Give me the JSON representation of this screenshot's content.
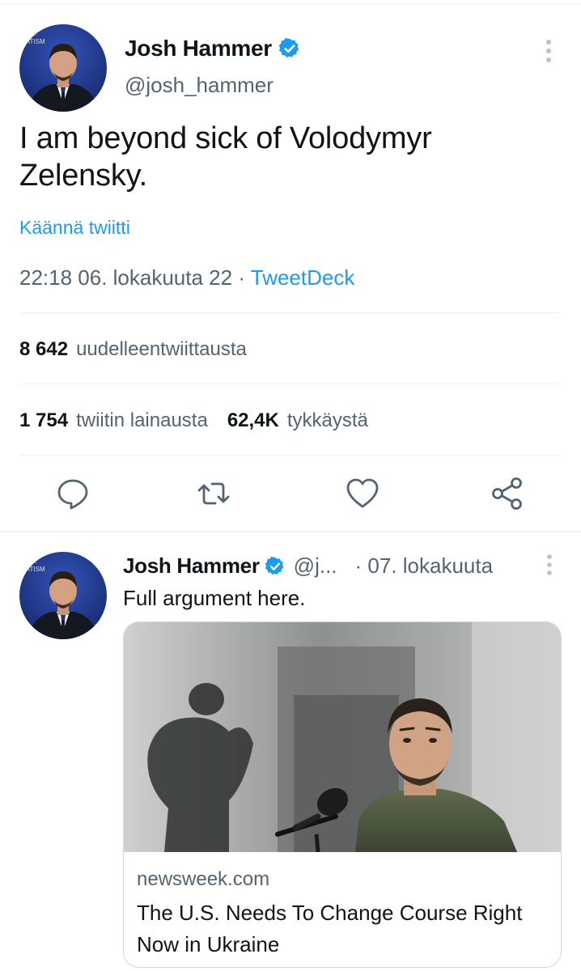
{
  "main_tweet": {
    "name": "Josh Hammer",
    "handle": "@josh_hammer",
    "text": "I am beyond sick of Volodymyr Zelensky.",
    "translate_label": "Käännä twiitti",
    "time": "22:18 06. lokakuuta 22",
    "separator": " · ",
    "source": "TweetDeck",
    "stats": {
      "retweets_count": "8 642",
      "retweets_label": "uudelleentwiittausta",
      "quotes_count": "1 754",
      "quotes_label": "twiitin lainausta",
      "likes_count": "62,4K",
      "likes_label": "tykkäystä"
    },
    "avatar_partial_text": "NAL\nNATISM"
  },
  "actions": [
    "reply-icon",
    "retweet-icon",
    "like-icon",
    "share-icon"
  ],
  "reply_tweet": {
    "name": "Josh Hammer",
    "handle": "@j...",
    "date": "· 07. lokakuuta",
    "text": "Full argument here.",
    "card": {
      "domain": "newsweek.com",
      "title": "The U.S. Needs To Change Course Right Now in Ukraine"
    }
  },
  "colors": {
    "link": "#1d9bf0",
    "secondary_text": "#536471",
    "primary_text": "#0f1419",
    "divider": "#eff3f4",
    "avatar_bg": "#1f3a8a"
  }
}
